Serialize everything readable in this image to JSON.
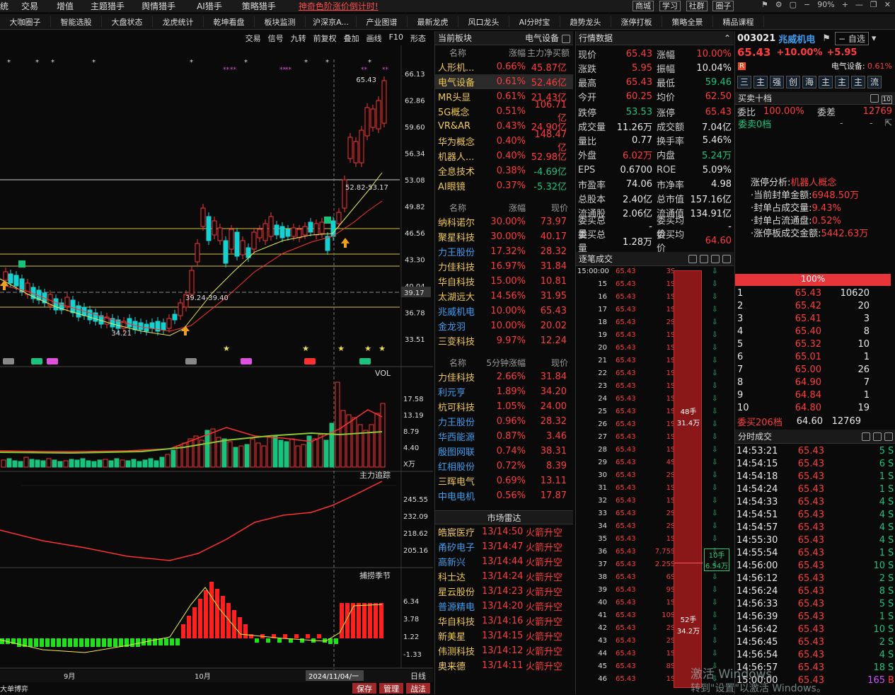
{
  "topbar": {
    "menus": [
      "统",
      "交易",
      "增值",
      "主题猎手",
      "舆情猎手",
      "AI猎手",
      "策略猎手"
    ],
    "promo": "神奇色阶涨价倒计时!",
    "buttons": [
      "商城",
      "学习",
      "社群",
      "圈子"
    ],
    "zoom": "90%"
  },
  "navbar": [
    "大咖圈子",
    "智能选股",
    "大盘状态",
    "龙虎统计",
    "乾坤看盘",
    "板块监测",
    "沪深京A...",
    "产业图谱",
    "最新龙虎",
    "风口龙头",
    "AI分时宝",
    "趋势龙头",
    "涨停打板",
    "策略全景",
    "精品课程"
  ],
  "chart": {
    "toolbar": [
      "交易",
      "信号",
      "九转",
      "前复权",
      "叠加",
      "画线",
      "F10",
      "形态"
    ],
    "price_axis": [
      "66.13",
      "62.86",
      "59.60",
      "56.34",
      "53.08",
      "49.82",
      "46.56",
      "43.30",
      "40.04",
      "36.78",
      "33.51"
    ],
    "last_price": "39.17",
    "label_high": "65.43",
    "label_range": "52.82-53.17",
    "label_range2": "39.24-39.40",
    "label_low": "34.21",
    "vol_title": "VOL",
    "vol_axis": [
      "17.58",
      "13.19",
      "8.79",
      "4.40",
      "X万"
    ],
    "main_title": "主力追踪",
    "main_axis": [
      "245.55",
      "232.09",
      "218.62",
      "205.16"
    ],
    "season_title": "捕捞季节",
    "season_axis": [
      "6.34",
      "3.78",
      "1.22",
      "-1.33"
    ],
    "date_labels": [
      "9月",
      "10月",
      "2024/11/04/一",
      "日线"
    ],
    "bottom_buttons": [
      "保存",
      "管理",
      "战法"
    ],
    "bottom_left": "大单博弈"
  },
  "sectors": {
    "title": "当前板块",
    "subtitle": "电气设备",
    "head1": [
      "名称",
      "涨幅",
      "主力净买额"
    ],
    "rows1": [
      [
        "人形机...",
        "0.66%",
        "45.87亿"
      ],
      [
        "电气设备",
        "0.61%",
        "52.46亿"
      ],
      [
        "MR头显",
        "0.61%",
        "21.43亿"
      ],
      [
        "5G概念",
        "0.51%",
        "106.71亿"
      ],
      [
        "VR&AR",
        "0.43%",
        "24.90亿"
      ],
      [
        "华为概念",
        "0.40%",
        "148.47亿"
      ],
      [
        "机器人...",
        "0.40%",
        "52.98亿"
      ],
      [
        "全息技术",
        "0.38%",
        "-4.69亿"
      ],
      [
        "AI眼镜",
        "0.37%",
        "-5.32亿"
      ]
    ],
    "head2": [
      "名称",
      "涨幅",
      "现价"
    ],
    "rows2": [
      [
        "纳科诺尔",
        "30.00%",
        "73.97"
      ],
      [
        "聚星科技",
        "30.00%",
        "40.17"
      ],
      [
        "力王股份",
        "17.32%",
        "28.32"
      ],
      [
        "力佳科技",
        "16.97%",
        "31.84"
      ],
      [
        "华自科技",
        "15.00%",
        "10.81"
      ],
      [
        "太湖远大",
        "14.56%",
        "31.95"
      ],
      [
        "兆威机电",
        "10.00%",
        "65.43"
      ],
      [
        "金龙羽",
        "10.00%",
        "20.02"
      ],
      [
        "三变科技",
        "9.97%",
        "12.24"
      ]
    ],
    "head3": [
      "名称",
      "5分钟涨幅",
      "现价"
    ],
    "rows3": [
      [
        "力佳科技",
        "2.66%",
        "31.84"
      ],
      [
        "利元亨",
        "1.89%",
        "34.20"
      ],
      [
        "杭可科技",
        "1.05%",
        "24.00"
      ],
      [
        "力王股份",
        "0.96%",
        "28.32"
      ],
      [
        "华西能源",
        "0.87%",
        "3.46"
      ],
      [
        "殷图网联",
        "0.74%",
        "38.31"
      ],
      [
        "红相股份",
        "0.72%",
        "8.39"
      ],
      [
        "三晖电气",
        "0.69%",
        "13.11"
      ],
      [
        "中电电机",
        "0.56%",
        "17.87"
      ]
    ],
    "radar_title": "市场雷达",
    "radar": [
      [
        "皓宸医疗",
        "13/14:50",
        "火箭升空"
      ],
      [
        "甬矽电子",
        "13/14:47",
        "火箭升空"
      ],
      [
        "高新兴",
        "13/14:44",
        "火箭升空"
      ],
      [
        "科士达",
        "13/14:24",
        "火箭升空"
      ],
      [
        "星云股份",
        "13/14:23",
        "火箭升空"
      ],
      [
        "普源精电",
        "13/14:20",
        "火箭升空"
      ],
      [
        "华自科技",
        "13/14:16",
        "火箭升空"
      ],
      [
        "新美星",
        "13/14:15",
        "火箭升空"
      ],
      [
        "伟测科技",
        "13/14:12",
        "火箭升空"
      ],
      [
        "奥来德",
        "13/14:11",
        "火箭升空"
      ]
    ]
  },
  "quotes": {
    "title": "行情数据",
    "rows": [
      [
        "现价",
        "65.43",
        "涨幅",
        "10.00%"
      ],
      [
        "涨跌",
        "5.95",
        "振幅",
        "10.04%"
      ],
      [
        "最高",
        "65.43",
        "最低",
        "59.46"
      ],
      [
        "今开",
        "60.25",
        "均价",
        "62.50"
      ],
      [
        "跌停",
        "53.53",
        "涨停",
        "65.43"
      ],
      [
        "成交量",
        "11.26万",
        "成交额",
        "7.04亿"
      ],
      [
        "量比",
        "0.77",
        "换手率",
        "5.46%"
      ],
      [
        "外盘",
        "6.02万",
        "内盘",
        "5.24万"
      ],
      [
        "EPS",
        "0.6700",
        "ROE",
        "5.09%"
      ],
      [
        "市盈率",
        "74.06",
        "市净率",
        "4.98"
      ],
      [
        "总股本",
        "2.40亿",
        "总市值",
        "157.16亿"
      ],
      [
        "流通股",
        "2.06亿",
        "流通值",
        "134.91亿"
      ],
      [
        "委买总量",
        "-",
        "委买均价",
        "-"
      ],
      [
        "委买总量",
        "1.28万",
        "委买均价",
        "64.60"
      ]
    ]
  },
  "ticks": {
    "title": "逐笔成交",
    "first_time": "15:00:00",
    "price": "65.43",
    "minutes": [
      "15",
      "16",
      "17",
      "18",
      "19",
      "20",
      "21",
      "22",
      "23",
      "24",
      "25",
      "26",
      "27",
      "28",
      "29",
      "30",
      "31",
      "32",
      "33",
      "34",
      "35",
      "36",
      "37",
      "38",
      "39",
      "40",
      "41",
      "42",
      "43",
      "44",
      "45",
      "46"
    ],
    "lots": [
      "3",
      "1",
      "1",
      "1",
      "2",
      "1",
      "1",
      "1",
      "1",
      "1",
      "1",
      "1",
      "1",
      "1",
      "1",
      "4",
      "2",
      "1",
      "1",
      "2",
      "2",
      "1",
      "7.75",
      "2.25",
      "6",
      "9",
      "1",
      "10",
      "2",
      "2",
      "1",
      "8",
      "1",
      "11"
    ],
    "bar_top_label": "48手",
    "bar_top_amt": "31.4万",
    "bar_bottom_label": "52手",
    "bar_bottom_amt": "34.2万",
    "mid_label": "10手",
    "mid_amt": "6.54万"
  },
  "right": {
    "code": "003021",
    "name": "兆威机电",
    "self_select": "自选",
    "price": "65.43",
    "pct": "+10.00%",
    "chg": "+5.95",
    "sector": "电气设备:",
    "sector_pct": "0.61%",
    "tabs": [
      "三",
      "主",
      "强",
      "创",
      "海",
      "主",
      "主",
      "主",
      "流"
    ],
    "ob_title": "买卖十档",
    "webi_label": "委比",
    "webi": "100.00%",
    "wecha_label": "委差",
    "wecha": "12769",
    "sell0": "委卖0档",
    "analysis": [
      "涨停分析:",
      "机器人概念",
      "·当前封单金额:",
      "6948.50万",
      "·封单占成交量:",
      "9.43%",
      "·封单占流通盘:",
      "0.52%",
      "·涨停板成交金额:",
      "5442.63万"
    ],
    "bar_label": "100%",
    "bids": [
      [
        "1",
        "65.43",
        "10620"
      ],
      [
        "2",
        "65.42",
        "20"
      ],
      [
        "3",
        "65.41",
        "3"
      ],
      [
        "4",
        "65.40",
        "8"
      ],
      [
        "5",
        "65.32",
        "10"
      ],
      [
        "6",
        "65.01",
        "1"
      ],
      [
        "7",
        "65.00",
        "26"
      ],
      [
        "8",
        "64.90",
        "7"
      ],
      [
        "9",
        "64.84",
        "1"
      ],
      [
        "10",
        "64.80",
        "19"
      ]
    ],
    "buy206": "委买206档",
    "buy206_p": "64.60",
    "buy206_v": "12769",
    "mt_title": "分时成交",
    "mt": [
      [
        "14:53:21",
        "65.43",
        "5",
        "S"
      ],
      [
        "14:54:15",
        "65.43",
        "6",
        "S"
      ],
      [
        "14:54:18",
        "65.43",
        "1",
        "S"
      ],
      [
        "14:54:24",
        "65.43",
        "1",
        "S"
      ],
      [
        "14:54:33",
        "65.43",
        "4",
        "S"
      ],
      [
        "14:54:51",
        "65.43",
        "4",
        "S"
      ],
      [
        "14:54:57",
        "65.43",
        "4",
        "S"
      ],
      [
        "14:55:30",
        "65.43",
        "4",
        "S"
      ],
      [
        "14:55:54",
        "65.43",
        "1",
        "S"
      ],
      [
        "14:56:00",
        "65.43",
        "10",
        "S"
      ],
      [
        "14:56:12",
        "65.43",
        "2",
        "S"
      ],
      [
        "14:56:24",
        "65.43",
        "8",
        "S"
      ],
      [
        "14:56:33",
        "65.43",
        "5",
        "S"
      ],
      [
        "14:56:39",
        "65.43",
        "1",
        "S"
      ],
      [
        "14:56:42",
        "65.43",
        "10",
        "S"
      ],
      [
        "14:56:45",
        "65.43",
        "2",
        "S"
      ],
      [
        "14:56:54",
        "65.43",
        "4",
        "S"
      ],
      [
        "14:56:57",
        "65.43",
        "18",
        "S"
      ],
      [
        "15:00:00",
        "65.43",
        "165",
        "B"
      ]
    ]
  },
  "watermark": [
    "激活 Windows",
    "转到\"设置\"以激活 Windows。"
  ]
}
